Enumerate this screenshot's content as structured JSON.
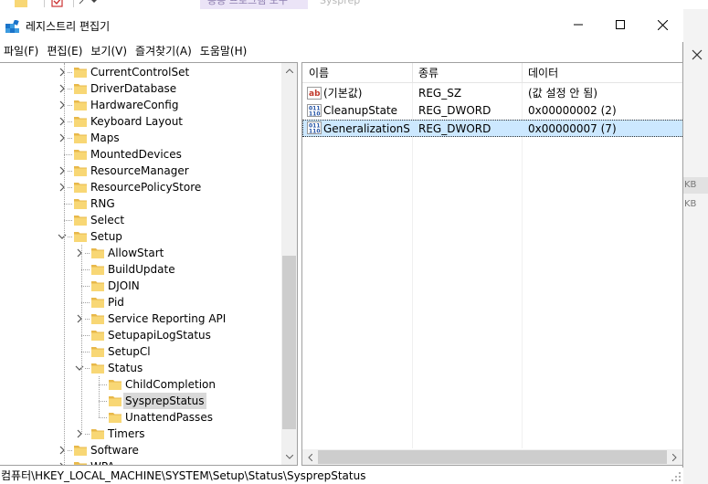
{
  "background_window": {
    "tab_active": "응용 프로그램 도구",
    "tab_title": "Sysprep",
    "right_fragments": [
      "KB",
      "KB"
    ]
  },
  "window": {
    "title": "레지스트리 편집기",
    "minimize_glyph": "minimize",
    "maximize_glyph": "maximize",
    "close_glyph": "close"
  },
  "menu": [
    {
      "name": "menu-file",
      "label": "파일(F)"
    },
    {
      "name": "menu-edit",
      "label": "편집(E)"
    },
    {
      "name": "menu-view",
      "label": "보기(V)"
    },
    {
      "name": "menu-favorites",
      "label": "즐겨찾기(A)"
    },
    {
      "name": "menu-help",
      "label": "도움말(H)"
    }
  ],
  "tree": [
    {
      "label": "CurrentControlSet",
      "level": 0,
      "chevron": "right"
    },
    {
      "label": "DriverDatabase",
      "level": 0,
      "chevron": "right"
    },
    {
      "label": "HardwareConfig",
      "level": 0,
      "chevron": "right"
    },
    {
      "label": "Keyboard Layout",
      "level": 0,
      "chevron": "right"
    },
    {
      "label": "Maps",
      "level": 0,
      "chevron": "right"
    },
    {
      "label": "MountedDevices",
      "level": 0,
      "chevron": "none"
    },
    {
      "label": "ResourceManager",
      "level": 0,
      "chevron": "right"
    },
    {
      "label": "ResourcePolicyStore",
      "level": 0,
      "chevron": "right"
    },
    {
      "label": "RNG",
      "level": 0,
      "chevron": "none"
    },
    {
      "label": "Select",
      "level": 0,
      "chevron": "none"
    },
    {
      "label": "Setup",
      "level": 0,
      "chevron": "down"
    },
    {
      "label": "AllowStart",
      "level": 1,
      "chevron": "right"
    },
    {
      "label": "BuildUpdate",
      "level": 1,
      "chevron": "none"
    },
    {
      "label": "DJOIN",
      "level": 1,
      "chevron": "none"
    },
    {
      "label": "Pid",
      "level": 1,
      "chevron": "none"
    },
    {
      "label": "Service Reporting API",
      "level": 1,
      "chevron": "right"
    },
    {
      "label": "SetupapiLogStatus",
      "level": 1,
      "chevron": "none"
    },
    {
      "label": "SetupCl",
      "level": 1,
      "chevron": "none"
    },
    {
      "label": "Status",
      "level": 1,
      "chevron": "down"
    },
    {
      "label": "ChildCompletion",
      "level": 2,
      "chevron": "none"
    },
    {
      "label": "SysprepStatus",
      "level": 2,
      "chevron": "none",
      "selected": true
    },
    {
      "label": "UnattendPasses",
      "level": 2,
      "chevron": "none"
    },
    {
      "label": "Timers",
      "level": 1,
      "chevron": "right"
    },
    {
      "label": "Software",
      "level": 0,
      "chevron": "right"
    },
    {
      "label": "WPA",
      "level": 0,
      "chevron": "right"
    }
  ],
  "values": {
    "columns": [
      "이름",
      "종류",
      "데이터"
    ],
    "rows": [
      {
        "icon": "string-value-icon",
        "name": "(기본값)",
        "type": "REG_SZ",
        "data": "(값 설정 안 됨)"
      },
      {
        "icon": "binary-value-icon",
        "name": "CleanupState",
        "type": "REG_DWORD",
        "data": "0x00000002 (2)"
      },
      {
        "icon": "binary-value-icon",
        "name": "GeneralizationS...",
        "type": "REG_DWORD",
        "data": "0x00000007 (7)",
        "selected": true
      }
    ]
  },
  "status_bar": {
    "path": "컴퓨터\\HKEY_LOCAL_MACHINE\\SYSTEM\\Setup\\Status\\SysprepStatus"
  },
  "colors": {
    "selection_blue": "#cce8ff",
    "tree_selection": "#d9d9d9",
    "folder_yellow": "#f8d775",
    "accent_tab": "#ebe4f7"
  }
}
